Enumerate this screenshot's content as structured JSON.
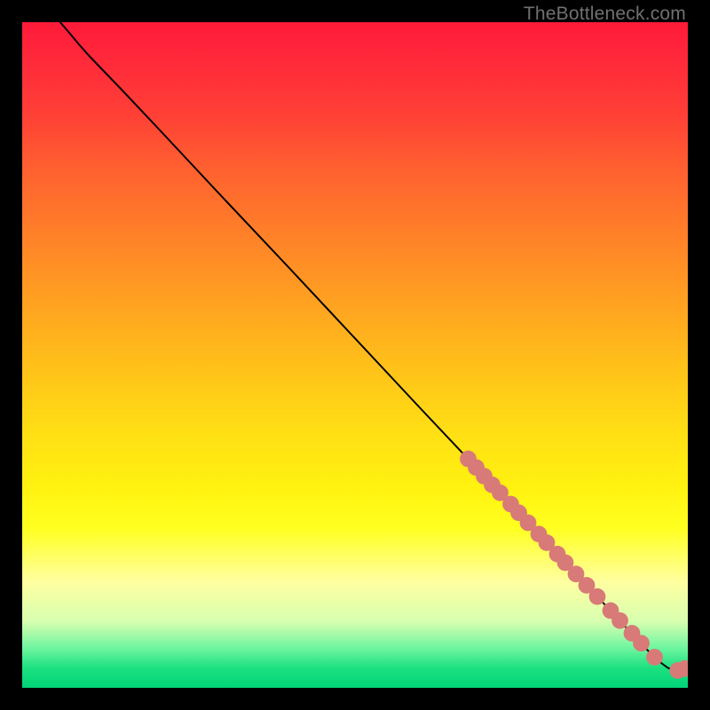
{
  "watermark": "TheBottleneck.com",
  "colors": {
    "background": "#000000",
    "curve_stroke": "#000000",
    "marker_fill": "#d87a78",
    "gradient_top": "#ff1a3a",
    "gradient_bottom": "#00d478"
  },
  "chart_data": {
    "type": "line",
    "title": "",
    "xlabel": "",
    "ylabel": "",
    "xlim": [
      0,
      100
    ],
    "ylim": [
      0,
      100
    ],
    "curve": [
      {
        "x": 5.7,
        "y": 100.0
      },
      {
        "x": 7.0,
        "y": 98.5
      },
      {
        "x": 8.5,
        "y": 96.7
      },
      {
        "x": 10.0,
        "y": 95.0
      },
      {
        "x": 12.5,
        "y": 92.4
      },
      {
        "x": 15.0,
        "y": 89.8
      },
      {
        "x": 20.0,
        "y": 84.5
      },
      {
        "x": 30.0,
        "y": 73.8
      },
      {
        "x": 40.0,
        "y": 63.2
      },
      {
        "x": 50.0,
        "y": 52.5
      },
      {
        "x": 60.0,
        "y": 41.8
      },
      {
        "x": 70.0,
        "y": 31.2
      },
      {
        "x": 80.0,
        "y": 20.5
      },
      {
        "x": 88.0,
        "y": 12.0
      },
      {
        "x": 93.0,
        "y": 6.6
      },
      {
        "x": 95.5,
        "y": 4.1
      },
      {
        "x": 97.0,
        "y": 3.0
      },
      {
        "x": 98.0,
        "y": 2.6
      },
      {
        "x": 99.0,
        "y": 2.7
      },
      {
        "x": 99.8,
        "y": 3.0
      }
    ],
    "markers": [
      {
        "x": 67.0,
        "y": 34.4
      },
      {
        "x": 68.2,
        "y": 33.1
      },
      {
        "x": 69.4,
        "y": 31.8
      },
      {
        "x": 70.6,
        "y": 30.5
      },
      {
        "x": 71.8,
        "y": 29.3
      },
      {
        "x": 73.4,
        "y": 27.6
      },
      {
        "x": 74.6,
        "y": 26.3
      },
      {
        "x": 76.0,
        "y": 24.8
      },
      {
        "x": 77.6,
        "y": 23.1
      },
      {
        "x": 78.8,
        "y": 21.8
      },
      {
        "x": 80.4,
        "y": 20.1
      },
      {
        "x": 81.6,
        "y": 18.8
      },
      {
        "x": 83.2,
        "y": 17.1
      },
      {
        "x": 84.8,
        "y": 15.4
      },
      {
        "x": 86.4,
        "y": 13.7
      },
      {
        "x": 88.4,
        "y": 11.6
      },
      {
        "x": 89.8,
        "y": 10.1
      },
      {
        "x": 91.6,
        "y": 8.2
      },
      {
        "x": 93.0,
        "y": 6.7
      },
      {
        "x": 95.0,
        "y": 4.6
      },
      {
        "x": 98.5,
        "y": 2.6
      },
      {
        "x": 99.6,
        "y": 2.9
      }
    ],
    "marker_radius": 1.25
  }
}
